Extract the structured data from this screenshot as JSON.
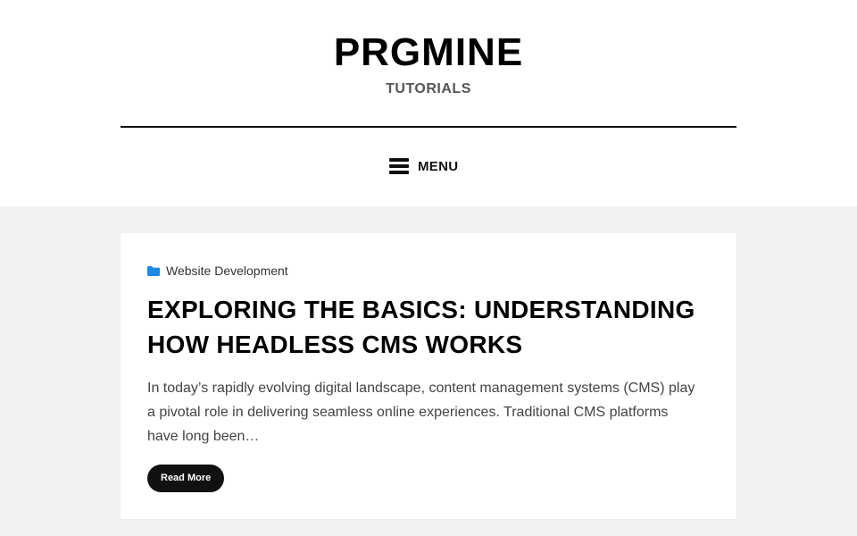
{
  "header": {
    "site_title": "PRGMINE",
    "tagline": "TUTORIALS",
    "menu_label": "MENU"
  },
  "post": {
    "category": "Website Development",
    "title": "EXPLORING THE BASICS: UNDERSTANDING HOW HEADLESS CMS WORKS",
    "excerpt": "In today’s rapidly evolving digital landscape, content management systems (CMS) play a pivotal role in delivering seamless online experiences. Traditional CMS platforms have long been…",
    "read_more_label": "Read More"
  },
  "icons": {
    "menu": "hamburger-icon",
    "category": "folder-icon"
  },
  "colors": {
    "header_bg": "#ffffff",
    "page_bg": "#f2f2f2",
    "text": "#111111",
    "category_icon": "#1e88e5",
    "button_bg": "#111111",
    "button_text": "#ffffff"
  }
}
